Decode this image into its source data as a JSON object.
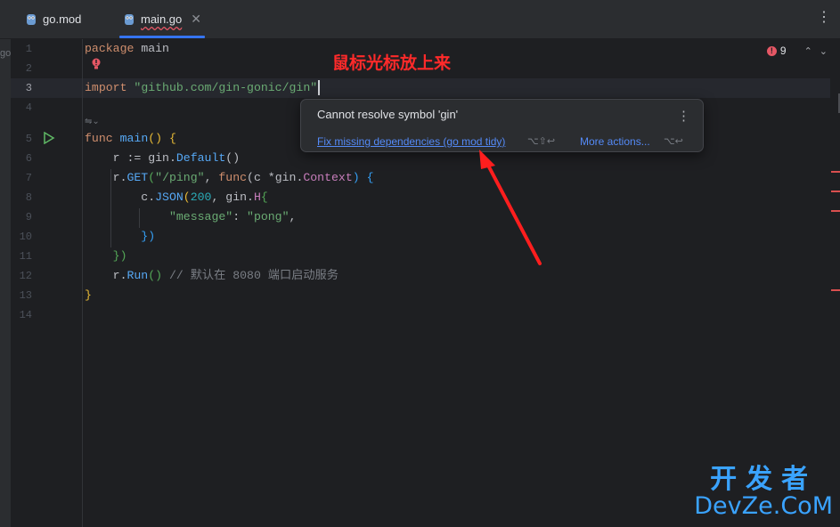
{
  "tabs": [
    {
      "label": "go.mod",
      "active": false
    },
    {
      "label": "main.go",
      "active": true
    }
  ],
  "left_strip_label": "go",
  "gutter": {
    "line_numbers": [
      "1",
      "2",
      "3",
      "4",
      "5",
      "6",
      "7",
      "8",
      "9",
      "10",
      "11",
      "12",
      "13",
      "14"
    ],
    "current_line": "3"
  },
  "code": {
    "l1_kw": "package",
    "l1_rest": " main",
    "l3_kw": "import",
    "l3_str": "\"github.com/gin-gonic/gin\"",
    "l5_kw": "func",
    "l5_fn": "main",
    "l5_rest": "() {",
    "l6_a": "    r := gin.",
    "l6_fn": "Default",
    "l6_b": "()",
    "l7_a": "    r.",
    "l7_fn": "GET",
    "l7_b": "(",
    "l7_str": "\"/ping\"",
    "l7_c": ", ",
    "l7_kw": "func",
    "l7_d": "(c *gin.",
    "l7_type": "Context",
    "l7_e": ") {",
    "l8_a": "        c.",
    "l8_fn": "JSON",
    "l8_b": "(",
    "l8_num": "200",
    "l8_c": ", gin.",
    "l8_type": "H",
    "l8_d": "{",
    "l9_a": "            ",
    "l9_str1": "\"message\"",
    "l9_b": ": ",
    "l9_str2": "\"pong\"",
    "l9_c": ",",
    "l10": "        })",
    "l11": "    })",
    "l12_a": "    r.",
    "l12_fn": "Run",
    "l12_b": "() ",
    "l12_cmt": "// 默认在 8080 端口启动服务",
    "l13": "}"
  },
  "annotation_text": "鼠标光标放上来",
  "popup": {
    "message": "Cannot resolve symbol 'gin'",
    "kebab": "⋮",
    "fix_action": "Fix missing dependencies (go mod tidy)",
    "fix_shortcut": "⌥⇧↩",
    "more_actions": "More actions...",
    "more_shortcut": "⌥↩"
  },
  "error_indicator": {
    "count": "9"
  },
  "watermark": {
    "top": "开发者",
    "bottom": "DevZe.CoM"
  },
  "colors": {
    "accent": "#3574f0",
    "error": "#e55765",
    "arrow": "#ff2a2a",
    "watermark": "#3aa3ff"
  }
}
